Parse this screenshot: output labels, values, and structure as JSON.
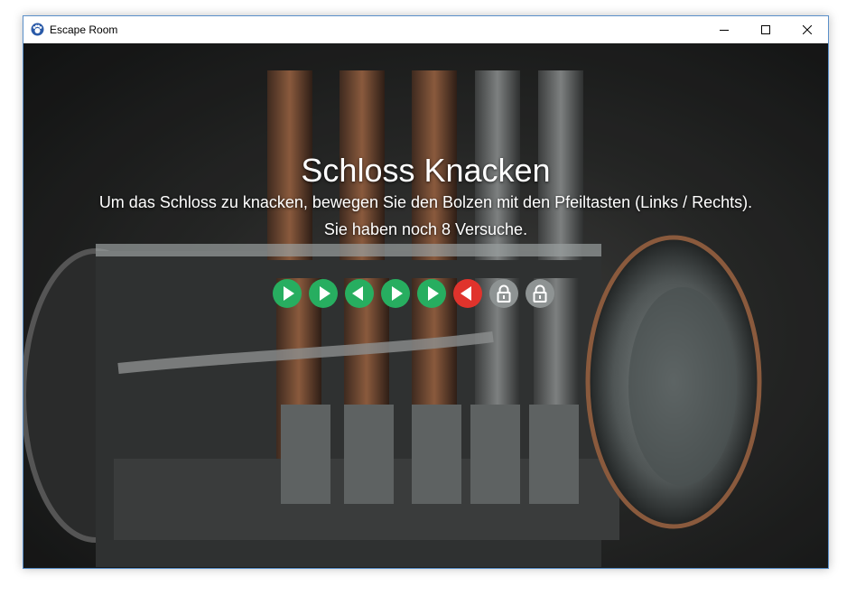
{
  "window": {
    "title": "Escape Room",
    "controls": [
      "minimize",
      "maximize",
      "close"
    ]
  },
  "game": {
    "heading": "Schloss Knacken",
    "instructions": "Um das Schloss zu knacken, bewegen Sie den Bolzen mit den Pfeiltasten (Links / Rechts).",
    "attempts_text": "Sie haben noch 8 Versuche."
  },
  "colors": {
    "green": "#27ae60",
    "red": "#e0332c",
    "gray": "#8e9393"
  },
  "pins": [
    {
      "state": "green",
      "icon": "play-right-icon"
    },
    {
      "state": "green",
      "icon": "play-right-icon"
    },
    {
      "state": "green",
      "icon": "play-left-icon"
    },
    {
      "state": "green",
      "icon": "play-right-icon"
    },
    {
      "state": "green",
      "icon": "play-right-icon"
    },
    {
      "state": "red",
      "icon": "play-left-icon"
    },
    {
      "state": "gray",
      "icon": "padlock-icon"
    },
    {
      "state": "gray",
      "icon": "padlock-icon"
    }
  ]
}
